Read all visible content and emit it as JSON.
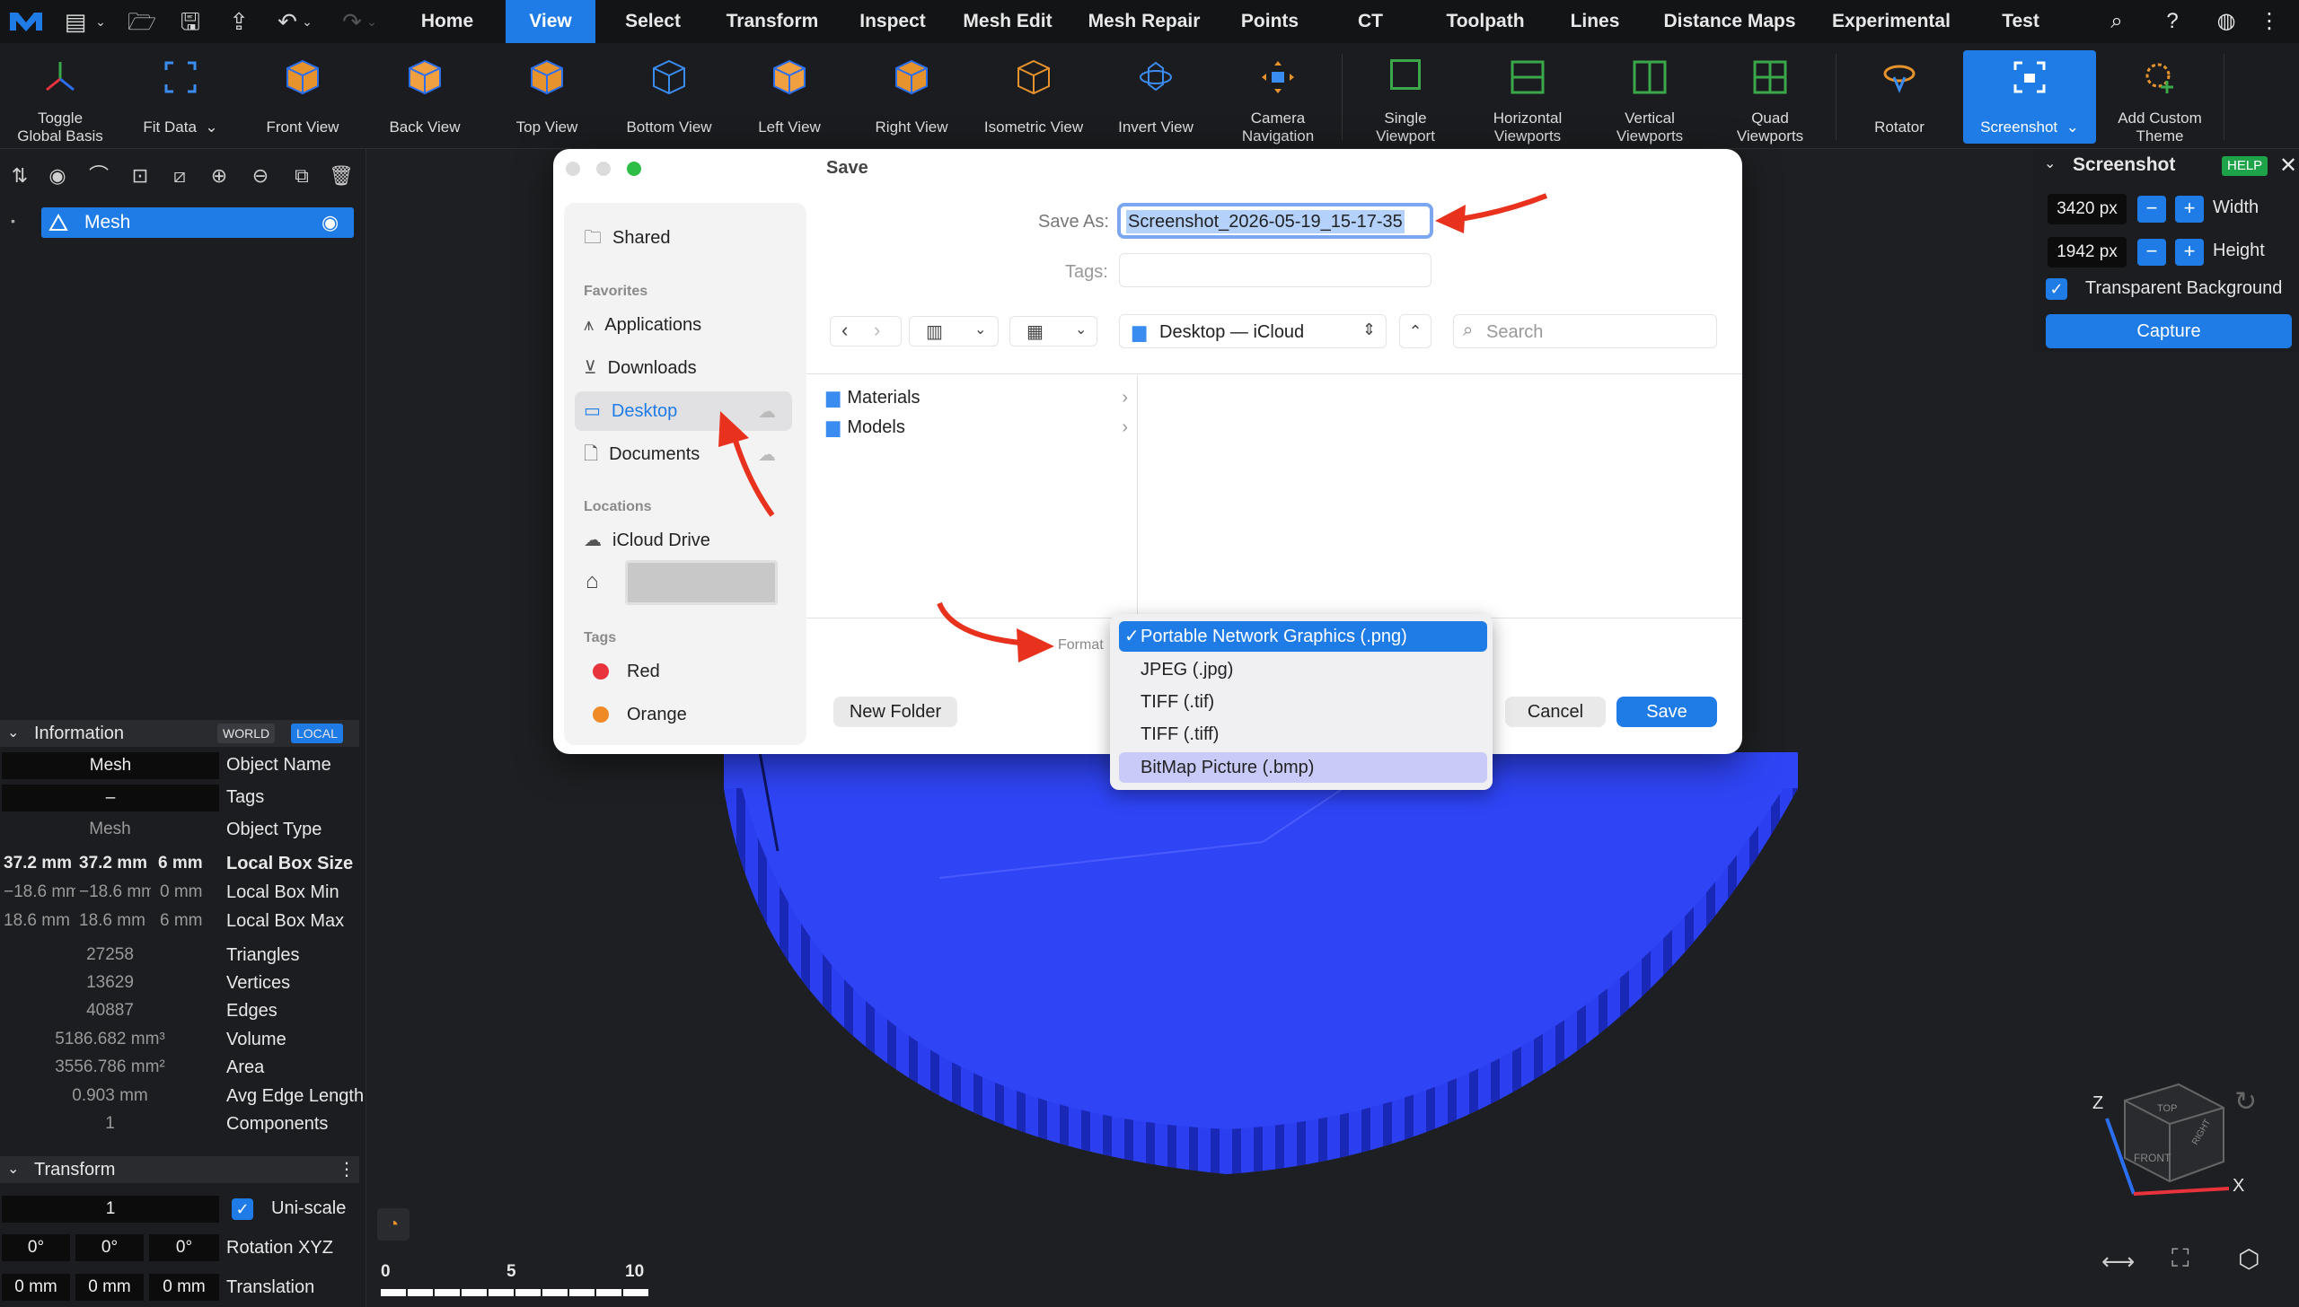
{
  "menubar": {
    "items": [
      "Home",
      "View",
      "Select",
      "Transform",
      "Inspect",
      "Mesh Edit",
      "Mesh Repair",
      "Points",
      "CT",
      "Toolpath",
      "Lines",
      "Distance Maps",
      "Experimental",
      "Test"
    ],
    "active": "View"
  },
  "ribbon": {
    "buttons": [
      {
        "label": "Toggle\nGlobal Basis",
        "icon": "axes-icon"
      },
      {
        "label": "Fit Data",
        "icon": "fit-data-icon"
      },
      {
        "label": "Front View",
        "icon": "front-view-cube-icon"
      },
      {
        "label": "Back View",
        "icon": "back-view-cube-icon"
      },
      {
        "label": "Top View",
        "icon": "top-view-cube-icon"
      },
      {
        "label": "Bottom View",
        "icon": "bottom-view-cube-icon"
      },
      {
        "label": "Left View",
        "icon": "left-view-cube-icon"
      },
      {
        "label": "Right View",
        "icon": "right-view-cube-icon"
      },
      {
        "label": "Isometric View",
        "icon": "isometric-view-cube-icon"
      },
      {
        "label": "Invert View",
        "icon": "invert-view-icon"
      },
      {
        "label": "Camera\nNavigation",
        "icon": "camera-navigation-icon"
      },
      {
        "label": "Single\nViewport",
        "icon": "single-viewport-icon"
      },
      {
        "label": "Horizontal\nViewports",
        "icon": "horizontal-viewports-icon"
      },
      {
        "label": "Vertical\nViewports",
        "icon": "vertical-viewports-icon"
      },
      {
        "label": "Quad\nViewports",
        "icon": "quad-viewports-icon"
      },
      {
        "label": "Rotator",
        "icon": "rotator-icon"
      },
      {
        "label": "Screenshot",
        "icon": "screenshot-icon"
      },
      {
        "label": "Add Custom\nTheme",
        "icon": "add-theme-icon"
      }
    ]
  },
  "scene": {
    "mesh_label": "Mesh"
  },
  "information": {
    "title": "Information",
    "world": "WORLD",
    "local": "LOCAL",
    "object_name_value": "Mesh",
    "object_name_label": "Object Name",
    "tags_value": "–",
    "tags_label": "Tags",
    "object_type_value": "Mesh",
    "object_type_label": "Object Type",
    "box_size": [
      "37.2 mm",
      "37.2 mm",
      "6 mm"
    ],
    "box_size_label": "Local Box Size",
    "box_min": [
      "−18.6 mm",
      "−18.6 mm",
      "0 mm"
    ],
    "box_min_label": "Local Box Min",
    "box_max": [
      "18.6 mm",
      "18.6 mm",
      "6 mm"
    ],
    "box_max_label": "Local Box Max",
    "stats": [
      {
        "value": "27258",
        "label": "Triangles"
      },
      {
        "value": "13629",
        "label": "Vertices"
      },
      {
        "value": "40887",
        "label": "Edges"
      },
      {
        "value": "5186.682 mm³",
        "label": "Volume"
      },
      {
        "value": "3556.786 mm²",
        "label": "Area"
      },
      {
        "value": "0.903 mm",
        "label": "Avg Edge Length"
      },
      {
        "value": "1",
        "label": "Components"
      }
    ]
  },
  "transform": {
    "title": "Transform",
    "scale_value": "1",
    "uniscale_label": "Uni-scale",
    "rotation": [
      "0°",
      "0°",
      "0°"
    ],
    "rotation_label": "Rotation XYZ",
    "translation": [
      "0 mm",
      "0 mm",
      "0 mm"
    ],
    "translation_label": "Translation"
  },
  "screenshot_panel": {
    "title": "Screenshot",
    "help": "HELP",
    "width_value": "3420 px",
    "width_label": "Width",
    "height_value": "1942 px",
    "height_label": "Height",
    "transparent_label": "Transparent Background",
    "capture_label": "Capture"
  },
  "save_dialog": {
    "title": "Save",
    "save_as_label": "Save As:",
    "save_as_value": "Screenshot_2026-05-19_15-17-35",
    "tags_label": "Tags:",
    "location": "Desktop — iCloud",
    "search_placeholder": "Search",
    "sidebar": {
      "shared": "Shared",
      "favorites_header": "Favorites",
      "favorites": [
        "Applications",
        "Downloads",
        "Desktop",
        "Documents"
      ],
      "locations_header": "Locations",
      "locations": [
        "iCloud Drive"
      ],
      "tags_header": "Tags",
      "tags": [
        {
          "name": "Red",
          "color": "#e8323c"
        },
        {
          "name": "Orange",
          "color": "#f08a24"
        }
      ]
    },
    "folders": [
      "Materials",
      "Models"
    ],
    "format_label": "Format",
    "format_options": [
      "Portable Network Graphics (.png)",
      "JPEG (.jpg)",
      "TIFF (.tif)",
      "TIFF (.tiff)",
      "BitMap Picture (.bmp)"
    ],
    "selected_format": "Portable Network Graphics (.png)",
    "new_folder_label": "New Folder",
    "cancel_label": "Cancel",
    "save_label": "Save"
  },
  "viewport": {
    "scale_ticks": [
      "0",
      "5",
      "10"
    ],
    "axis_z": "Z",
    "axis_x": "X",
    "cube_top": "TOP",
    "cube_front": "FRONT",
    "cube_right": "RIGHT"
  },
  "colors": {
    "accent": "#1f7ce6",
    "gear": "#2b3ff0",
    "bg": "#1e1f22",
    "arrow": "#e8321e"
  }
}
